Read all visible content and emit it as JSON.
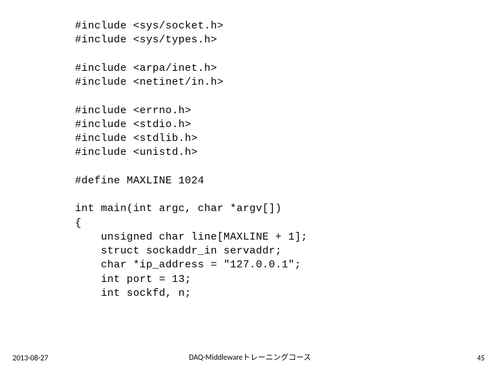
{
  "code": {
    "lines": [
      "#include <sys/socket.h>",
      "#include <sys/types.h>",
      "",
      "#include <arpa/inet.h>",
      "#include <netinet/in.h>",
      "",
      "#include <errno.h>",
      "#include <stdio.h>",
      "#include <stdlib.h>",
      "#include <unistd.h>",
      "",
      "#define MAXLINE 1024",
      "",
      "int main(int argc, char *argv[])",
      "{",
      "    unsigned char line[MAXLINE + 1];",
      "    struct sockaddr_in servaddr;",
      "    char *ip_address = \"127.0.0.1\";",
      "    int port = 13;",
      "    int sockfd, n;"
    ]
  },
  "footer": {
    "date": "2013-08-27",
    "title": "DAQ-Middlewareトレーニングコース",
    "page": "45"
  }
}
